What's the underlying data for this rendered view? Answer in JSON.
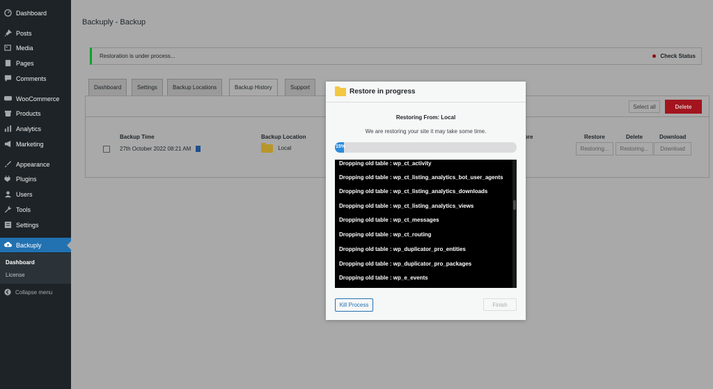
{
  "sidebar": {
    "items": [
      {
        "label": "Dashboard",
        "icon": "dashboard-icon"
      },
      {
        "label": "Posts",
        "icon": "pin-icon"
      },
      {
        "label": "Media",
        "icon": "media-icon"
      },
      {
        "label": "Pages",
        "icon": "pages-icon"
      },
      {
        "label": "Comments",
        "icon": "comment-icon"
      },
      {
        "label": "WooCommerce",
        "icon": "woocommerce-icon"
      },
      {
        "label": "Products",
        "icon": "archive-icon"
      },
      {
        "label": "Analytics",
        "icon": "bar-chart-icon"
      },
      {
        "label": "Marketing",
        "icon": "megaphone-icon"
      },
      {
        "label": "Appearance",
        "icon": "paintbrush-icon"
      },
      {
        "label": "Plugins",
        "icon": "plug-icon"
      },
      {
        "label": "Users",
        "icon": "users-icon"
      },
      {
        "label": "Tools",
        "icon": "wrench-icon"
      },
      {
        "label": "Settings",
        "icon": "settings-icon"
      },
      {
        "label": "Backuply",
        "icon": "cloud-upload-icon"
      }
    ],
    "submenu": [
      "Dashboard",
      "License"
    ],
    "collapse_label": "Collapse menu"
  },
  "page": {
    "title": "Backuply - Backup",
    "notice": "Restoration is under process...",
    "check_status": "Check Status"
  },
  "tabs": [
    "Dashboard",
    "Settings",
    "Backup Locations",
    "Backup History",
    "Support"
  ],
  "active_tab": "Backup History",
  "table": {
    "select_all": "Select all",
    "delete": "Delete",
    "headers": {
      "backup_time": "Backup Time",
      "backup_location": "Backup Location",
      "note": "ore",
      "restore": "Restore",
      "delete": "Delete",
      "download": "Download"
    },
    "row": {
      "time": "27th October 2022 08:21 AM",
      "location": "Local",
      "restore": "Restoring...",
      "delete": "Restoring...",
      "download": "Download"
    }
  },
  "modal": {
    "title": "Restore in progress",
    "restoring_from": "Restoring From: Local",
    "description": "We are restoring your site it may take some time.",
    "progress_label": "15%",
    "progress": 0.05,
    "log": [
      "Dropping old table : wp_ct_activity",
      "Dropping old table : wp_ct_listing_analytics_bot_user_agents",
      "Dropping old table : wp_ct_listing_analytics_downloads",
      "Dropping old table : wp_ct_listing_analytics_views",
      "Dropping old table : wp_ct_messages",
      "Dropping old table : wp_ct_routing",
      "Dropping old table : wp_duplicator_pro_entities",
      "Dropping old table : wp_duplicator_pro_packages",
      "Dropping old table : wp_e_events"
    ],
    "kill_label": "Kill Process",
    "finish_label": "Finish"
  },
  "colors": {
    "sidebar_bg": "#1d2327",
    "accent": "#2271b1",
    "danger": "#d63638",
    "notice_green": "#00a32a"
  }
}
